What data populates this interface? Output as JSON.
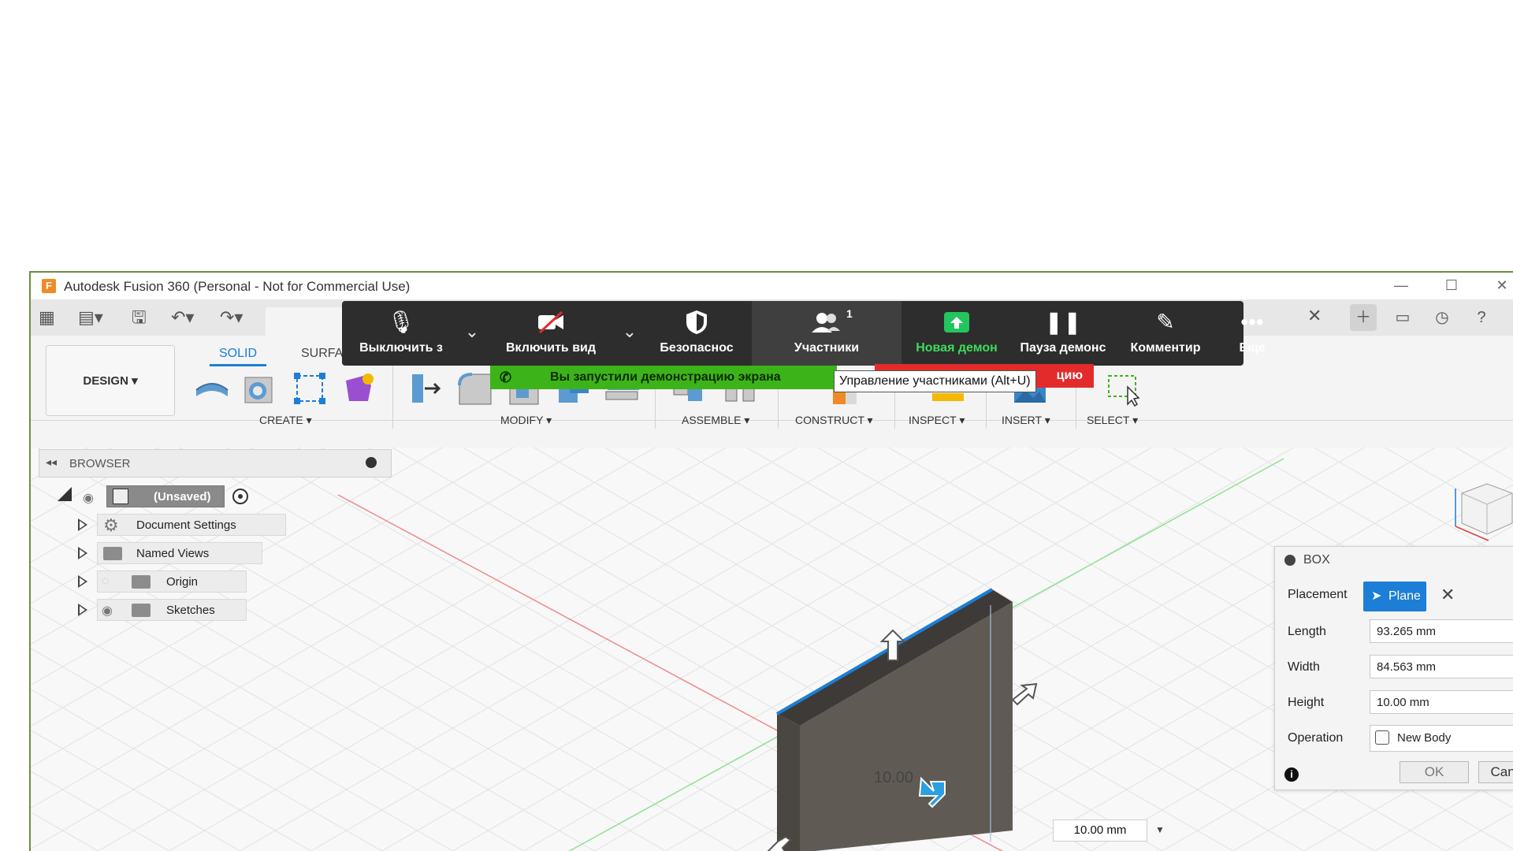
{
  "window": {
    "title": "Autodesk Fusion 360 (Personal - Not for Commercial Use)",
    "logo": "F"
  },
  "workspace": {
    "design_label": "DESIGN ▾",
    "tabs": [
      "SOLID",
      "SURFAC"
    ],
    "groups": {
      "create": "CREATE ▾",
      "modify": "MODIFY ▾",
      "assemble": "ASSEMBLE ▾",
      "construct": "CONSTRUCT ▾",
      "inspect": "INSPECT ▾",
      "insert": "INSERT ▾",
      "select": "SELECT ▾"
    }
  },
  "browser": {
    "title": "BROWSER",
    "root": "(Unsaved)",
    "items": [
      "Document Settings",
      "Named Views",
      "Origin",
      "Sketches"
    ]
  },
  "dialog": {
    "title": "BOX",
    "placement_label": "Placement",
    "placement_value": "Plane",
    "length_label": "Length",
    "length_value": "93.265 mm",
    "width_label": "Width",
    "width_value": "84.563 mm",
    "height_label": "Height",
    "height_value": "10.00 mm",
    "operation_label": "Operation",
    "operation_value": "New Body",
    "ok_label": "OK",
    "cancel_label": "Cancel"
  },
  "viewport": {
    "dimension_label": "10.00",
    "dimension_input": "10.00 mm"
  },
  "zoom": {
    "mute": "Выключить з",
    "video": "Включить вид",
    "security": "Безопаснос",
    "participants": "Участники",
    "participants_count": "1",
    "share": "Новая демон",
    "pause": "Пауза демонс",
    "annotate": "Комментир",
    "more": "Еще",
    "share_banner": "Вы запустили демонстрацию экрана",
    "stop_banner": "цию",
    "tooltip": "Управление участниками (Alt+U)"
  },
  "colors": {
    "zoom_bg": "#2d2d2d",
    "share_green": "#3cb419",
    "stop_red": "#e32b2b",
    "fusion_blue": "#1c7ed6",
    "body_fill": "#5f5a55"
  }
}
